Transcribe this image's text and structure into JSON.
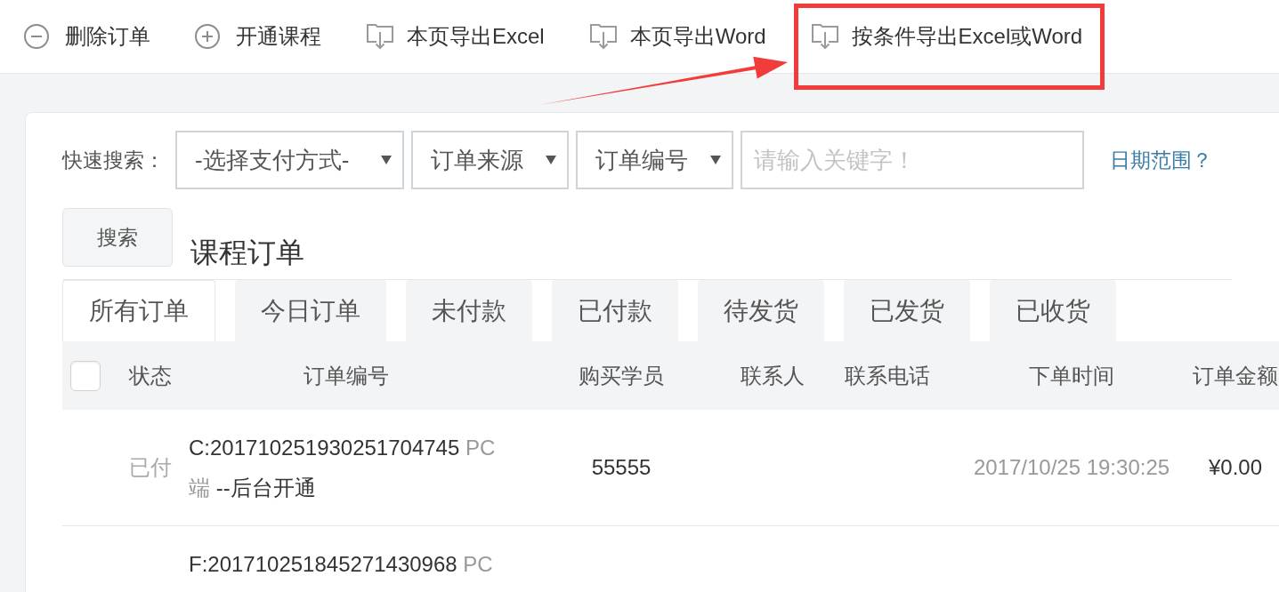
{
  "toolbar": {
    "buttons": [
      {
        "kind": "remove",
        "label": "删除订单",
        "highlighted": false
      },
      {
        "kind": "add",
        "label": "开通课程",
        "highlighted": false
      },
      {
        "kind": "export",
        "label": "本页导出Excel",
        "highlighted": false
      },
      {
        "kind": "export",
        "label": "本页导出Word",
        "highlighted": false
      },
      {
        "kind": "export",
        "label": "按条件导出Excel或Word",
        "highlighted": true
      }
    ]
  },
  "search": {
    "label": "快速搜索：",
    "selects": [
      {
        "value": "-选择支付方式-"
      },
      {
        "value": "订单来源"
      },
      {
        "value": "订单编号"
      }
    ],
    "keyword": {
      "placeholder": "请输入关键字！"
    },
    "date_range_link": "日期范围？",
    "button": "搜索"
  },
  "title": "课程订单",
  "tabs": [
    {
      "label": "所有订单",
      "selected": true
    },
    {
      "label": "今日订单",
      "selected": false
    },
    {
      "label": "未付款",
      "selected": false
    },
    {
      "label": "已付款",
      "selected": false
    },
    {
      "label": "待发货",
      "selected": false
    },
    {
      "label": "已发货",
      "selected": false
    },
    {
      "label": "已收货",
      "selected": false
    }
  ],
  "table": {
    "select_all": {
      "checked": false
    },
    "columns": [
      "状态",
      "订单编号",
      "购买学员",
      "联系人",
      "联系电话",
      "下单时间",
      "订单金额"
    ],
    "rows": [
      {
        "status": "已付",
        "order_no": "C:201710251930251704745",
        "source": "PC端",
        "note": "--后台开通",
        "buyer": "55555",
        "time": "2017/10/25 19:30:25",
        "amount": "¥0.00"
      },
      {
        "order_no": "F:201710251845271430968",
        "source": "PC"
      }
    ]
  }
}
